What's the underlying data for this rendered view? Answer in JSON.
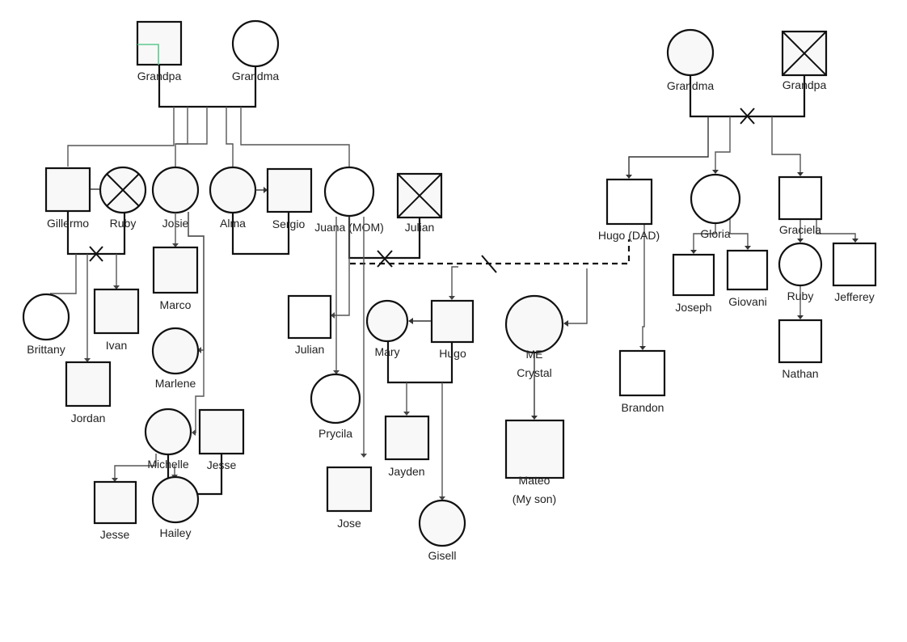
{
  "diagram": {
    "type": "genogram",
    "people": {
      "grandpa_left": {
        "name": "Grandpa",
        "sex": "male",
        "deceased": false
      },
      "grandma_left": {
        "name": "Grandma",
        "sex": "female",
        "deceased": false
      },
      "gillermo": {
        "name": "Gillermo",
        "sex": "male",
        "deceased": false
      },
      "ruby_left": {
        "name": "Ruby",
        "sex": "female",
        "deceased": true
      },
      "josie": {
        "name": "Josie",
        "sex": "female",
        "deceased": false
      },
      "alma": {
        "name": "Alma",
        "sex": "female",
        "deceased": false
      },
      "sergio": {
        "name": "Sergio",
        "sex": "male",
        "deceased": false
      },
      "juana": {
        "name": "Juana (MOM)",
        "sex": "female",
        "deceased": false
      },
      "julian_top": {
        "name": "Julian",
        "sex": "male",
        "deceased": true
      },
      "brittany": {
        "name": "Brittany",
        "sex": "female",
        "deceased": false
      },
      "ivan": {
        "name": "Ivan",
        "sex": "male",
        "deceased": false
      },
      "jordan": {
        "name": "Jordan",
        "sex": "male",
        "deceased": false
      },
      "marco": {
        "name": "Marco",
        "sex": "male",
        "deceased": false
      },
      "marlene": {
        "name": "Marlene",
        "sex": "female",
        "deceased": false
      },
      "michelle": {
        "name": "Michelle",
        "sex": "female",
        "deceased": false
      },
      "jesse_spouse": {
        "name": "Jesse",
        "sex": "male",
        "deceased": false
      },
      "jesse_child": {
        "name": "Jesse",
        "sex": "male",
        "deceased": false
      },
      "hailey": {
        "name": "Hailey",
        "sex": "female",
        "deceased": false
      },
      "julian_child": {
        "name": "Julian",
        "sex": "male",
        "deceased": false
      },
      "prycila": {
        "name": "Prycila",
        "sex": "female",
        "deceased": false
      },
      "jose": {
        "name": "Jose",
        "sex": "male",
        "deceased": false
      },
      "mary": {
        "name": "Mary",
        "sex": "female",
        "deceased": false
      },
      "hugo_child": {
        "name": "Hugo",
        "sex": "male",
        "deceased": false
      },
      "jayden": {
        "name": "Jayden",
        "sex": "male",
        "deceased": false
      },
      "gisell": {
        "name": "Gisell",
        "sex": "female",
        "deceased": false
      },
      "me_line1": {
        "name": "ME",
        "sex": "female",
        "deceased": false
      },
      "me_line2": {
        "name": "Crystal"
      },
      "mateo_line1": {
        "name": "Mateo",
        "sex": "male",
        "deceased": false
      },
      "mateo_line2": {
        "name": "(My son)"
      },
      "hugo_dad": {
        "name": "Hugo (DAD)",
        "sex": "male",
        "deceased": false
      },
      "brandon": {
        "name": "Brandon",
        "sex": "male",
        "deceased": false
      },
      "grandma_right": {
        "name": "Grandma",
        "sex": "female",
        "deceased": false
      },
      "grandpa_right": {
        "name": "Grandpa",
        "sex": "male",
        "deceased": true
      },
      "gloria": {
        "name": "Gloria",
        "sex": "female",
        "deceased": false
      },
      "graciela": {
        "name": "Graciela",
        "sex": "male",
        "deceased": false
      },
      "joseph": {
        "name": "Joseph",
        "sex": "male",
        "deceased": false
      },
      "giovani": {
        "name": "Giovani",
        "sex": "male",
        "deceased": false
      },
      "ruby_right": {
        "name": "Ruby",
        "sex": "female",
        "deceased": false
      },
      "jefferey": {
        "name": "Jefferey",
        "sex": "male",
        "deceased": false
      },
      "nathan": {
        "name": "Nathan",
        "sex": "male",
        "deceased": false
      }
    },
    "relationships": [
      {
        "a": "grandpa_left",
        "b": "grandma_left",
        "type": "married"
      },
      {
        "a": "gillermo",
        "b": "ruby_left",
        "type": "divorced"
      },
      {
        "a": "alma",
        "b": "sergio",
        "type": "married"
      },
      {
        "a": "juana",
        "b": "julian_top",
        "type": "divorced"
      },
      {
        "a": "juana",
        "b": "hugo_dad",
        "type": "separated-unmarried"
      },
      {
        "a": "michelle",
        "b": "jesse_spouse",
        "type": "married"
      },
      {
        "a": "mary",
        "b": "hugo_child",
        "type": "married"
      },
      {
        "a": "grandma_right",
        "b": "grandpa_right",
        "type": "divorced"
      }
    ]
  }
}
